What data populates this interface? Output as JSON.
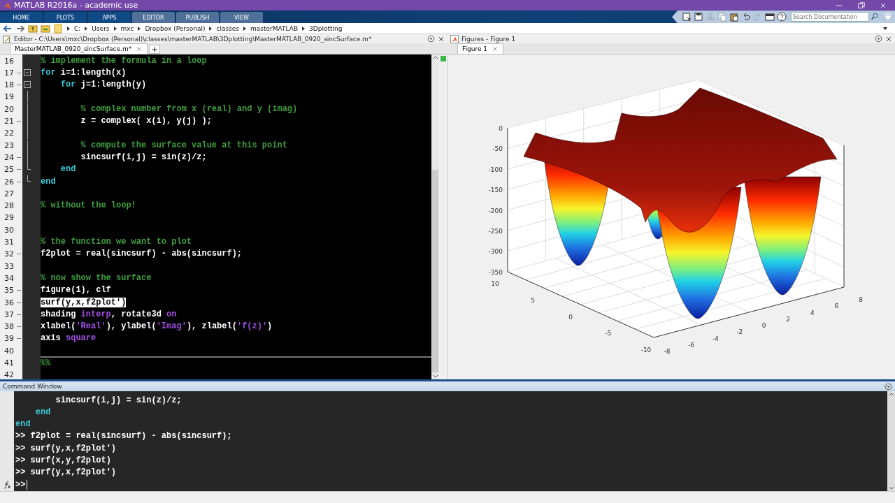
{
  "window": {
    "title": "MATLAB R2016a - academic use"
  },
  "ribbon": {
    "tabs": [
      {
        "label": "HOME",
        "kind": "global",
        "selected": false
      },
      {
        "label": "PLOTS",
        "kind": "global",
        "selected": false
      },
      {
        "label": "APPS",
        "kind": "global",
        "selected": false
      },
      {
        "label": "EDITOR",
        "kind": "contextual",
        "selected": false
      },
      {
        "label": "PUBLISH",
        "kind": "contextual",
        "selected": false
      },
      {
        "label": "VIEW",
        "kind": "contextual",
        "selected": false
      }
    ],
    "toolbar": [
      {
        "kind": "export",
        "disabled": false
      },
      {
        "kind": "save",
        "disabled": false
      },
      {
        "kind": "cut",
        "disabled": true
      },
      {
        "kind": "copy",
        "disabled": true
      },
      {
        "kind": "paste",
        "disabled": false
      },
      {
        "kind": "undo",
        "disabled": false
      },
      {
        "kind": "redo",
        "disabled": true
      },
      {
        "kind": "layout",
        "disabled": false
      },
      {
        "kind": "help",
        "disabled": false
      }
    ],
    "search": {
      "placeholder": "Search Documentation"
    }
  },
  "address_bar": {
    "path": [
      "C:",
      "Users",
      "mxc",
      "Dropbox (Personal)",
      "classes",
      "masterMATLAB",
      "3Dplotting"
    ]
  },
  "editor": {
    "title": "Editor - C:\\Users\\mxc\\Dropbox (Personal)\\classes\\masterMATLAB\\3Dplotting\\MasterMATLAB_0920_sincSurface.m*",
    "tabs": [
      {
        "label": "MasterMATLAB_0920_sincSurface.m*",
        "selected": true
      }
    ],
    "lines": [
      {
        "number": "16",
        "executable": false,
        "foldable": false,
        "in_fold": false,
        "fold_end": false,
        "tokens": [
          {
            "kind": "comment",
            "text": "% implement the formula in a loop"
          }
        ]
      },
      {
        "number": "17",
        "executable": true,
        "foldable": true,
        "in_fold": false,
        "fold_end": false,
        "tokens": [
          {
            "kind": "keyword",
            "text": "for"
          },
          {
            "kind": "code",
            "text": " i=1:length(x)"
          }
        ]
      },
      {
        "number": "18",
        "executable": true,
        "foldable": true,
        "in_fold": false,
        "fold_end": false,
        "tokens": [
          {
            "kind": "keyword",
            "text": "    for"
          },
          {
            "kind": "code",
            "text": " j=1:length(y)"
          }
        ]
      },
      {
        "number": "19",
        "executable": false,
        "foldable": false,
        "in_fold": true,
        "fold_end": false
      },
      {
        "number": "20",
        "executable": false,
        "foldable": false,
        "in_fold": true,
        "fold_end": false,
        "tokens": [
          {
            "kind": "comment",
            "text": "        % complex number from x (real) and y (imag)"
          }
        ]
      },
      {
        "number": "21",
        "executable": true,
        "foldable": false,
        "in_fold": true,
        "fold_end": false,
        "tokens": [
          {
            "kind": "code",
            "text": "        z = complex( x(i), y(j) );"
          }
        ]
      },
      {
        "number": "22",
        "executable": false,
        "foldable": false,
        "in_fold": true,
        "fold_end": false
      },
      {
        "number": "23",
        "executable": false,
        "foldable": false,
        "in_fold": true,
        "fold_end": false,
        "tokens": [
          {
            "kind": "comment",
            "text": "        % compute the surface value at this point"
          }
        ]
      },
      {
        "number": "24",
        "executable": true,
        "foldable": false,
        "in_fold": true,
        "fold_end": false,
        "tokens": [
          {
            "kind": "code",
            "text": "        sincsurf(i,j) = sin(z)/z;"
          }
        ]
      },
      {
        "number": "25",
        "executable": true,
        "foldable": false,
        "in_fold": false,
        "fold_end": true,
        "tokens": [
          {
            "kind": "keyword",
            "text": "    end"
          }
        ]
      },
      {
        "number": "26",
        "executable": true,
        "foldable": false,
        "in_fold": false,
        "fold_end": true,
        "tokens": [
          {
            "kind": "keyword",
            "text": "end"
          }
        ]
      },
      {
        "number": "27",
        "executable": false,
        "foldable": false,
        "in_fold": false,
        "fold_end": false
      },
      {
        "number": "28",
        "executable": false,
        "foldable": false,
        "in_fold": false,
        "fold_end": false,
        "tokens": [
          {
            "kind": "comment",
            "text": "% without the loop!"
          }
        ]
      },
      {
        "number": "29",
        "executable": false,
        "foldable": false,
        "in_fold": false,
        "fold_end": false
      },
      {
        "number": "30",
        "executable": false,
        "foldable": false,
        "in_fold": false,
        "fold_end": false
      },
      {
        "number": "31",
        "executable": false,
        "foldable": false,
        "in_fold": false,
        "fold_end": false,
        "tokens": [
          {
            "kind": "comment",
            "text": "% the function we want to plot"
          }
        ]
      },
      {
        "number": "32",
        "executable": true,
        "foldable": false,
        "in_fold": false,
        "fold_end": false,
        "tokens": [
          {
            "kind": "code",
            "text": "f2plot = real(sincsurf) - abs(sincsurf);"
          }
        ]
      },
      {
        "number": "33",
        "executable": false,
        "foldable": false,
        "in_fold": false,
        "fold_end": false
      },
      {
        "number": "34",
        "executable": false,
        "foldable": false,
        "in_fold": false,
        "fold_end": false,
        "tokens": [
          {
            "kind": "comment",
            "text": "% now show the surface"
          }
        ]
      },
      {
        "number": "35",
        "executable": true,
        "foldable": false,
        "in_fold": false,
        "fold_end": false,
        "tokens": [
          {
            "kind": "code",
            "text": "figure(1), clf"
          }
        ]
      },
      {
        "number": "36",
        "executable": true,
        "foldable": false,
        "in_fold": false,
        "fold_end": false,
        "tokens": [
          {
            "kind": "selected",
            "text": "surf(y,x,f2plot')"
          }
        ]
      },
      {
        "number": "37",
        "executable": true,
        "foldable": false,
        "in_fold": false,
        "fold_end": false,
        "tokens": [
          {
            "kind": "code",
            "text": "shading "
          },
          {
            "kind": "string",
            "text": "interp"
          },
          {
            "kind": "code",
            "text": ", rotate3d "
          },
          {
            "kind": "string",
            "text": "on"
          }
        ]
      },
      {
        "number": "38",
        "executable": true,
        "foldable": false,
        "in_fold": false,
        "fold_end": false,
        "tokens": [
          {
            "kind": "code",
            "text": "xlabel("
          },
          {
            "kind": "string",
            "text": "'Real'"
          },
          {
            "kind": "code",
            "text": "), ylabel("
          },
          {
            "kind": "string",
            "text": "'Imag'"
          },
          {
            "kind": "code",
            "text": "), zlabel("
          },
          {
            "kind": "string",
            "text": "'f(z)'"
          },
          {
            "kind": "code",
            "text": ")"
          }
        ]
      },
      {
        "number": "39",
        "executable": true,
        "foldable": false,
        "in_fold": false,
        "fold_end": false,
        "tokens": [
          {
            "kind": "code",
            "text": "axis "
          },
          {
            "kind": "string",
            "text": "square"
          }
        ]
      },
      {
        "number": "40",
        "executable": false,
        "foldable": false,
        "in_fold": false,
        "fold_end": false
      },
      {
        "number": "41",
        "executable": false,
        "foldable": false,
        "in_fold": false,
        "fold_end": false,
        "section_start": true,
        "tokens": [
          {
            "kind": "comment",
            "text": "%%"
          }
        ]
      },
      {
        "number": "42",
        "executable": false,
        "foldable": false,
        "in_fold": false,
        "fold_end": false
      }
    ]
  },
  "figures": {
    "title": "Figures - Figure 1",
    "tabs": [
      {
        "label": "Figure 1",
        "selected": true
      }
    ],
    "axes": {
      "zticks": [
        "0",
        "-50",
        "-100",
        "-150",
        "-200",
        "-250",
        "-300",
        "-350"
      ],
      "yticks": [
        "10",
        "5",
        "0",
        "-5",
        "-10"
      ],
      "xticks": [
        "-8",
        "-6",
        "-4",
        "-2",
        "0",
        "2",
        "4",
        "6",
        "8"
      ]
    }
  },
  "command_window": {
    "title": "Command Window",
    "lines": [
      {
        "tokens": [
          {
            "kind": "code",
            "text": "        sincsurf(i,j) = sin(z)/z;"
          }
        ]
      },
      {
        "tokens": [
          {
            "kind": "keyword",
            "text": "    end"
          }
        ]
      },
      {
        "tokens": [
          {
            "kind": "keyword",
            "text": "end"
          }
        ]
      },
      {
        "tokens": [
          {
            "kind": "prompt",
            "text": ">>"
          },
          {
            "kind": "code",
            "text": " f2plot = real(sincsurf) - abs(sincsurf);"
          }
        ]
      },
      {
        "tokens": [
          {
            "kind": "prompt",
            "text": ">>"
          },
          {
            "kind": "code",
            "text": " surf(y,x,f2plot')"
          }
        ]
      },
      {
        "tokens": [
          {
            "kind": "prompt",
            "text": ">>"
          },
          {
            "kind": "code",
            "text": " surf(x,y,f2plot)"
          }
        ]
      },
      {
        "tokens": [
          {
            "kind": "prompt",
            "text": ">>"
          },
          {
            "kind": "code",
            "text": " surf(y,x,f2plot')"
          }
        ]
      }
    ],
    "prompt": ">>"
  }
}
